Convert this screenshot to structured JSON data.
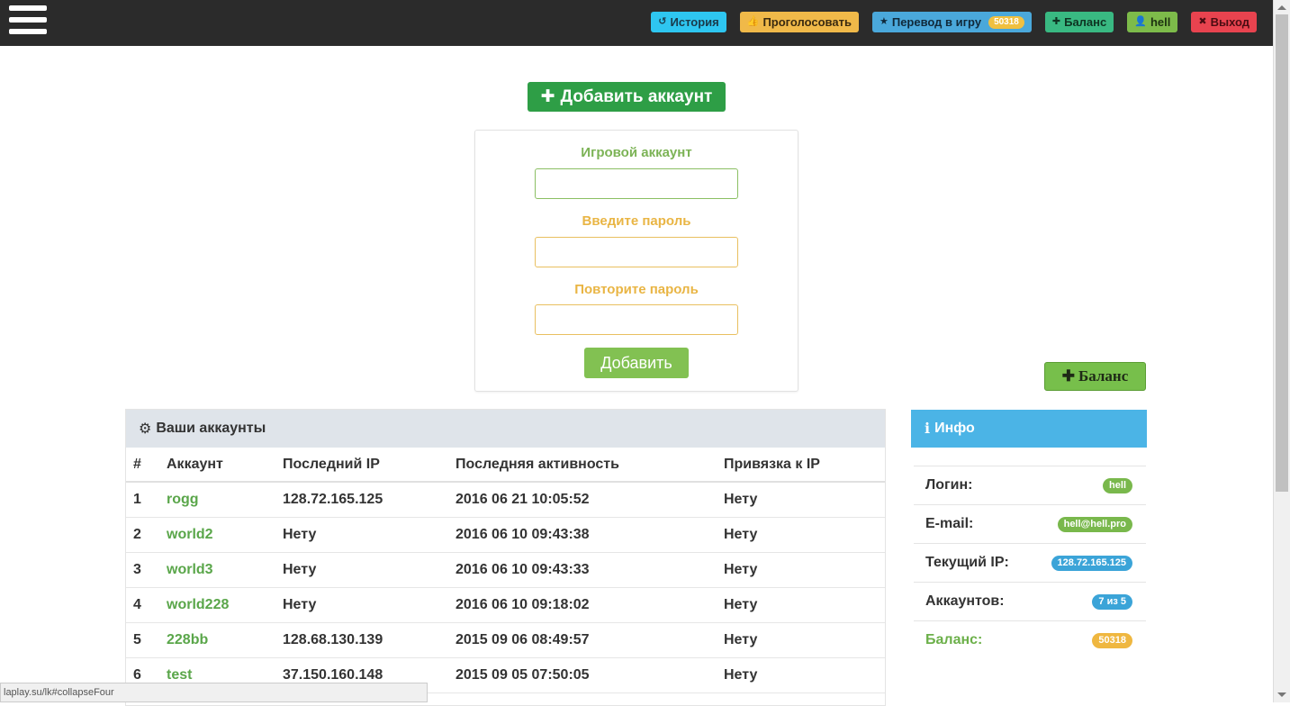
{
  "nav": {
    "history": "История",
    "vote": "Проголосовать",
    "transfer": "Перевод в игру",
    "transfer_badge": "50318",
    "balance": "Баланс",
    "user": "hell",
    "exit": "Выход"
  },
  "add_account_button": "Добавить аккаунт",
  "form": {
    "account_label": "Игровой аккаунт",
    "password_label": "Введите пароль",
    "repeat_label": "Повторите пароль",
    "account_value": "",
    "password_value": "",
    "repeat_value": "",
    "submit": "Добавить"
  },
  "balance_button": "Баланс",
  "accounts": {
    "title": "Ваши аккаунты",
    "headers": [
      "#",
      "Аккаунт",
      "Последний IP",
      "Последняя активность",
      "Привязка к IP"
    ],
    "rows": [
      {
        "n": "1",
        "name": "rogg",
        "ip": "128.72.165.125",
        "activity": "2016 06 21 10:05:52",
        "bind": "Нету"
      },
      {
        "n": "2",
        "name": "world2",
        "ip": "Нету",
        "activity": "2016 06 10 09:43:38",
        "bind": "Нету"
      },
      {
        "n": "3",
        "name": "world3",
        "ip": "Нету",
        "activity": "2016 06 10 09:43:33",
        "bind": "Нету"
      },
      {
        "n": "4",
        "name": "world228",
        "ip": "Нету",
        "activity": "2016 06 10 09:18:02",
        "bind": "Нету"
      },
      {
        "n": "5",
        "name": "228bb",
        "ip": "128.68.130.139",
        "activity": "2015 09 06 08:49:57",
        "bind": "Нету"
      },
      {
        "n": "6",
        "name": "test",
        "ip": "37.150.160.148",
        "activity": "2015 09 05 07:50:05",
        "bind": "Нету"
      }
    ]
  },
  "info": {
    "title": "Инфо",
    "login_label": "Логин:",
    "login_value": "hell",
    "email_label": "E-mail:",
    "email_value": "hell@hell.pro",
    "ip_label": "Текущий IP:",
    "ip_value": "128.72.165.125",
    "accounts_label": "Аккаунтов:",
    "accounts_value": "7 из 5",
    "balance_label": "Баланс:",
    "balance_value": "50318"
  },
  "status_url": "laplay.su/lk#collapseFour",
  "colors": {
    "topbar": "#2b2b2b",
    "green_primary": "#2e9e46",
    "info_blue": "#4bb4e6",
    "link_green": "#5aa64a"
  }
}
